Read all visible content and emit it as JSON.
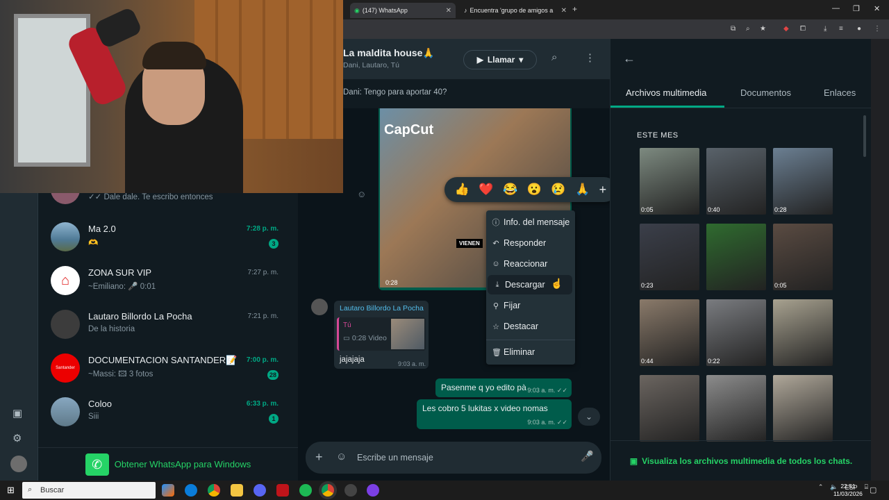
{
  "browser": {
    "tabs": [
      {
        "title": "(147) WhatsApp",
        "active": true
      },
      {
        "title": "Encuentra 'grupo de amigos a",
        "active": false
      }
    ]
  },
  "chat_header": {
    "title": "La maldita house🙏",
    "subtitle": "Dani, Lautaro, Tú",
    "call_label": "Llamar"
  },
  "pinned": {
    "text": "Dani: Tengo para aportar 40?"
  },
  "chat_list": [
    {
      "name": "",
      "preview": "✓✓ Dale dale. Te escribo entonces",
      "time": "",
      "badge": "",
      "green": false,
      "avatar_color": "#8a5a6b"
    },
    {
      "name": "Ma 2.0",
      "preview": "🫶",
      "time": "7:28 p. m.",
      "badge": "3",
      "green": true,
      "avatar_color": "#4f7a96"
    },
    {
      "name": "ZONA SUR VIP",
      "preview": "~Emiliano: 🎤 0:01",
      "time": "7:27 p. m.",
      "badge": "",
      "green": false,
      "avatar_color": "#ffffff"
    },
    {
      "name": "Lautaro Billordo La Pocha",
      "preview": "De la historia",
      "time": "7:21 p. m.",
      "badge": "",
      "green": false,
      "avatar_color": "#3c3c3c"
    },
    {
      "name": "DOCUMENTACION SANTANDER📝",
      "preview": "~Massi: 🖾 3 fotos",
      "time": "7:00 p. m.",
      "badge": "28",
      "green": true,
      "avatar_color": "#ec0000"
    },
    {
      "name": "Coloo",
      "preview": "Siii",
      "time": "6:33 p. m.",
      "badge": "1",
      "green": true,
      "avatar_color": "#5f7a8a"
    }
  ],
  "get_app": {
    "label": "Obtener WhatsApp para Windows"
  },
  "video_message": {
    "duration": "0:28",
    "watermark": "CapCut",
    "overlay": "VIENEN"
  },
  "reactions": [
    "👍",
    "❤️",
    "😂",
    "😮",
    "😢",
    "🙏"
  ],
  "context_menu": [
    {
      "label": "Info. del mensaje",
      "icon": "ⓘ"
    },
    {
      "label": "Responder",
      "icon": "↶"
    },
    {
      "label": "Reaccionar",
      "icon": "☺"
    },
    {
      "label": "Descargar",
      "icon": "⤓"
    },
    {
      "label": "Fijar",
      "icon": "⚲"
    },
    {
      "label": "Destacar",
      "icon": "☆"
    },
    {
      "label": "Eliminar",
      "icon": "🗑"
    }
  ],
  "incoming": {
    "author": "Lautaro Billordo La Pocha",
    "quote_author": "Tú",
    "quote_text": "▭ 0:28 Video",
    "text": "jajajaja",
    "time": "9:03 a. m."
  },
  "outgoing": [
    {
      "text": "Pasenme q yo edito pà",
      "time": "9:03 a. m. ✓✓"
    },
    {
      "text": "Les cobro 5 lukitas x video nomas",
      "time": "9:03 a. m. ✓✓"
    }
  ],
  "composer": {
    "placeholder": "Escribe un mensaje"
  },
  "media_panel": {
    "tabs": [
      "Archivos multimedia",
      "Documentos",
      "Enlaces"
    ],
    "section": "ESTE MES",
    "items": [
      {
        "duration": "0:05",
        "color": "#7d8a80"
      },
      {
        "duration": "0:40",
        "color": "#59626a"
      },
      {
        "duration": "0:28",
        "color": "#6b7f92"
      },
      {
        "duration": "0:23",
        "color": "#3b3f4a"
      },
      {
        "duration": "",
        "color": "#2f6b2f"
      },
      {
        "duration": "0:05",
        "color": "#5a4b42"
      },
      {
        "duration": "0:44",
        "color": "#8a7a6a"
      },
      {
        "duration": "0:22",
        "color": "#7a7c80"
      },
      {
        "duration": "",
        "color": "#a8a290"
      },
      {
        "duration": "",
        "color": "#6b6560"
      },
      {
        "duration": "",
        "color": "#8c8c8c"
      },
      {
        "duration": "",
        "color": "#b0a89a"
      }
    ],
    "footer": "Visualiza los archivos multimedia de todos los chats."
  },
  "taskbar": {
    "search_placeholder": "Buscar",
    "lang": "ESP",
    "time": "22:51",
    "date": "11/03/2026"
  }
}
